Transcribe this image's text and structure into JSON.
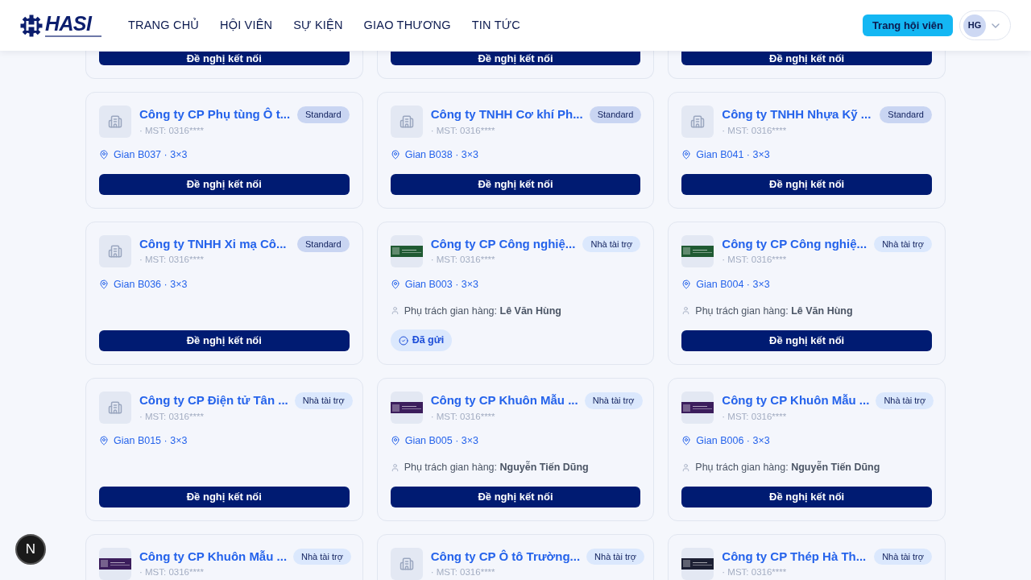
{
  "header": {
    "logo": "HASI",
    "nav": [
      {
        "label": "TRANG CHỦ",
        "selected": false
      },
      {
        "label": "HỘI VIÊN",
        "selected": false
      },
      {
        "label": "SỰ KIỆN",
        "selected": false
      },
      {
        "label": "GIAO THƯƠNG",
        "selected": false
      },
      {
        "label": "TIN TỨC",
        "selected": false
      }
    ],
    "member_button": "Trang hội viên",
    "avatar": "HG"
  },
  "top_row": [
    {
      "action": "Đề nghị kết nối"
    },
    {
      "action": "Đề nghị kết nối"
    },
    {
      "action": "Đề nghị kết nối"
    }
  ],
  "cards": [
    {
      "name": "Công ty CP Phụ tùng Ô t...",
      "badge": {
        "label": "Standard",
        "kind": "standard"
      },
      "logo": {
        "kind": "placeholder"
      },
      "tax": "· MST: 0316****",
      "booth": "Gian B037 · 3×3",
      "action": {
        "label": "Đề nghị kết nối",
        "sent": false
      }
    },
    {
      "name": "Công ty TNHH Cơ khí Ph...",
      "badge": {
        "label": "Standard",
        "kind": "standard"
      },
      "logo": {
        "kind": "placeholder"
      },
      "tax": "· MST: 0316****",
      "booth": "Gian B038 · 3×3",
      "action": {
        "label": "Đề nghị kết nối",
        "sent": false
      }
    },
    {
      "name": "Công ty TNHH Nhựa Kỹ ...",
      "badge": {
        "label": "Standard",
        "kind": "standard"
      },
      "logo": {
        "kind": "placeholder"
      },
      "tax": "· MST: 0316****",
      "booth": "Gian B041 · 3×3",
      "action": {
        "label": "Đề nghị kết nối",
        "sent": false
      }
    },
    {
      "name": "Công ty TNHH Xi mạ Cô...",
      "badge": {
        "label": "Standard",
        "kind": "standard"
      },
      "logo": {
        "kind": "placeholder"
      },
      "tax": "· MST: 0316****",
      "booth": "Gian B036 · 3×3",
      "action": {
        "label": "Đề nghị kết nối",
        "sent": false
      }
    },
    {
      "name": "Công ty CP Công nghiệ...",
      "badge": {
        "label": "Nhà tài trợ",
        "kind": "sponsor"
      },
      "logo": {
        "kind": "banner",
        "color": "#1f5a32"
      },
      "tax": "· MST: 0316****",
      "booth": "Gian B003 · 3×3",
      "manager_label": "Phụ trách gian hàng:",
      "manager": "Lê Văn Hùng",
      "action": {
        "label": "Đã gửi",
        "sent": true
      }
    },
    {
      "name": "Công ty CP Công nghiệ...",
      "badge": {
        "label": "Nhà tài trợ",
        "kind": "sponsor"
      },
      "logo": {
        "kind": "banner",
        "color": "#1f5a32"
      },
      "tax": "· MST: 0316****",
      "booth": "Gian B004 · 3×3",
      "manager_label": "Phụ trách gian hàng:",
      "manager": "Lê Văn Hùng",
      "action": {
        "label": "Đề nghị kết nối",
        "sent": false
      }
    },
    {
      "name": "Công ty CP Điện tử Tân ...",
      "badge": {
        "label": "Nhà tài trợ",
        "kind": "sponsor"
      },
      "logo": {
        "kind": "placeholder"
      },
      "tax": "· MST: 0316****",
      "booth": "Gian B015 · 3×3",
      "action": {
        "label": "Đề nghị kết nối",
        "sent": false
      }
    },
    {
      "name": "Công ty CP Khuôn Mẫu ...",
      "badge": {
        "label": "Nhà tài trợ",
        "kind": "sponsor"
      },
      "logo": {
        "kind": "banner",
        "color": "#3b1d5c"
      },
      "tax": "· MST: 0316****",
      "booth": "Gian B005 · 3×3",
      "manager_label": "Phụ trách gian hàng:",
      "manager": "Nguyễn Tiến Dũng",
      "action": {
        "label": "Đề nghị kết nối",
        "sent": false
      }
    },
    {
      "name": "Công ty CP Khuôn Mẫu ...",
      "badge": {
        "label": "Nhà tài trợ",
        "kind": "sponsor"
      },
      "logo": {
        "kind": "banner",
        "color": "#3b1d5c"
      },
      "tax": "· MST: 0316****",
      "booth": "Gian B006 · 3×3",
      "manager_label": "Phụ trách gian hàng:",
      "manager": "Nguyễn Tiến Dũng",
      "action": {
        "label": "Đề nghị kết nối",
        "sent": false
      }
    },
    {
      "name": "Công ty CP Khuôn Mẫu ...",
      "badge": {
        "label": "Nhà tài trợ",
        "kind": "sponsor"
      },
      "logo": {
        "kind": "banner",
        "color": "#3b1d5c"
      },
      "tax": "· MST: 0316****"
    },
    {
      "name": "Công ty CP Ô tô Trường...",
      "badge": {
        "label": "Nhà tài trợ",
        "kind": "sponsor"
      },
      "logo": {
        "kind": "placeholder"
      },
      "tax": "· MST: 0316****"
    },
    {
      "name": "Công ty CP Thép Hà Th...",
      "badge": {
        "label": "Nhà tài trợ",
        "kind": "sponsor"
      },
      "logo": {
        "kind": "banner",
        "color": "#1c1f33"
      },
      "tax": "· MST: 0316****"
    }
  ],
  "dev_indicator": "N"
}
